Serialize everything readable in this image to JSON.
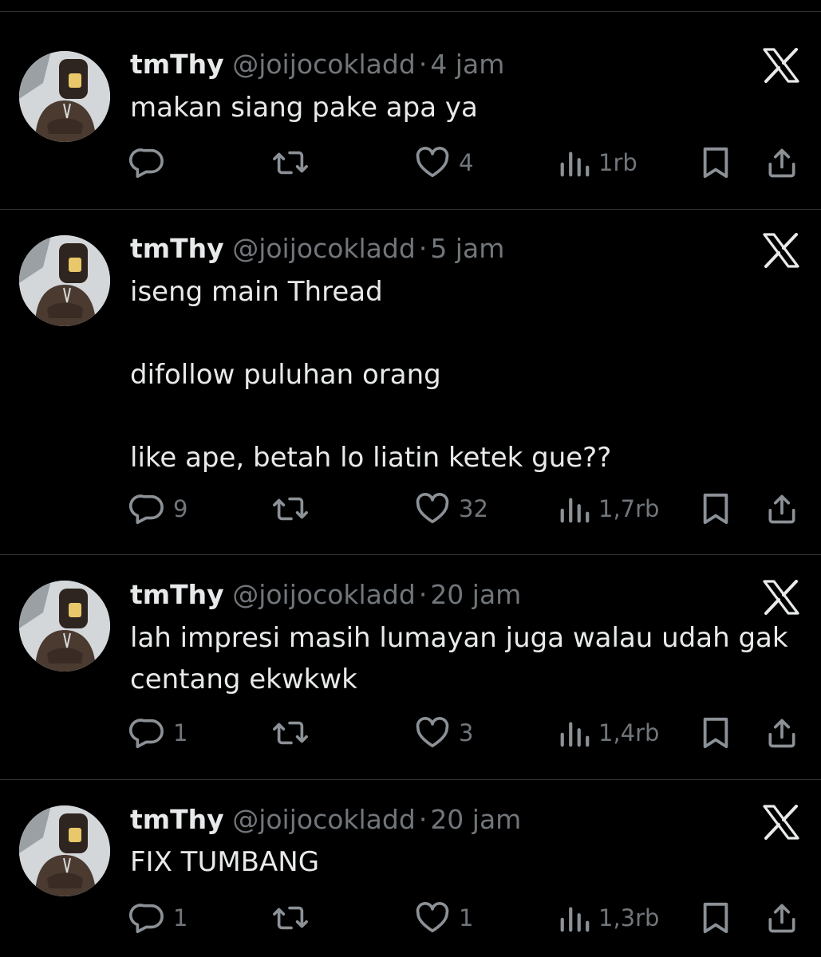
{
  "colors": {
    "background": "#000000",
    "text_primary": "#e7e9ea",
    "text_secondary": "#71767b",
    "divider": "#2f3336"
  },
  "posts": [
    {
      "author_name": "tmThy",
      "handle": "@joijocokladd",
      "separator": "·",
      "time": "4 jam",
      "lines": [
        "makan siang pake apa ya"
      ],
      "replies": "",
      "retweets": "",
      "likes": "4",
      "views": "1rb"
    },
    {
      "author_name": "tmThy",
      "handle": "@joijocokladd",
      "separator": "·",
      "time": "5 jam",
      "lines": [
        "iseng main Thread",
        "",
        "difollow puluhan orang",
        "",
        "like ape, betah lo liatin ketek gue??"
      ],
      "replies": "9",
      "retweets": "",
      "likes": "32",
      "views": "1,7rb"
    },
    {
      "author_name": "tmThy",
      "handle": "@joijocokladd",
      "separator": "·",
      "time": "20 jam",
      "lines": [
        "lah impresi masih lumayan juga walau udah gak centang ekwkwk"
      ],
      "replies": "1",
      "retweets": "",
      "likes": "3",
      "views": "1,4rb"
    },
    {
      "author_name": "tmThy",
      "handle": "@joijocokladd",
      "separator": "·",
      "time": "20 jam",
      "lines": [
        "FIX TUMBANG"
      ],
      "replies": "1",
      "retweets": "",
      "likes": "1",
      "views": "1,3rb"
    }
  ],
  "icons": {
    "avatar": "profile-photo",
    "platform": "x-logo-icon",
    "reply": "reply-icon",
    "retweet": "retweet-icon",
    "like": "heart-icon",
    "views": "views-icon",
    "bookmark": "bookmark-icon",
    "share": "share-icon"
  }
}
